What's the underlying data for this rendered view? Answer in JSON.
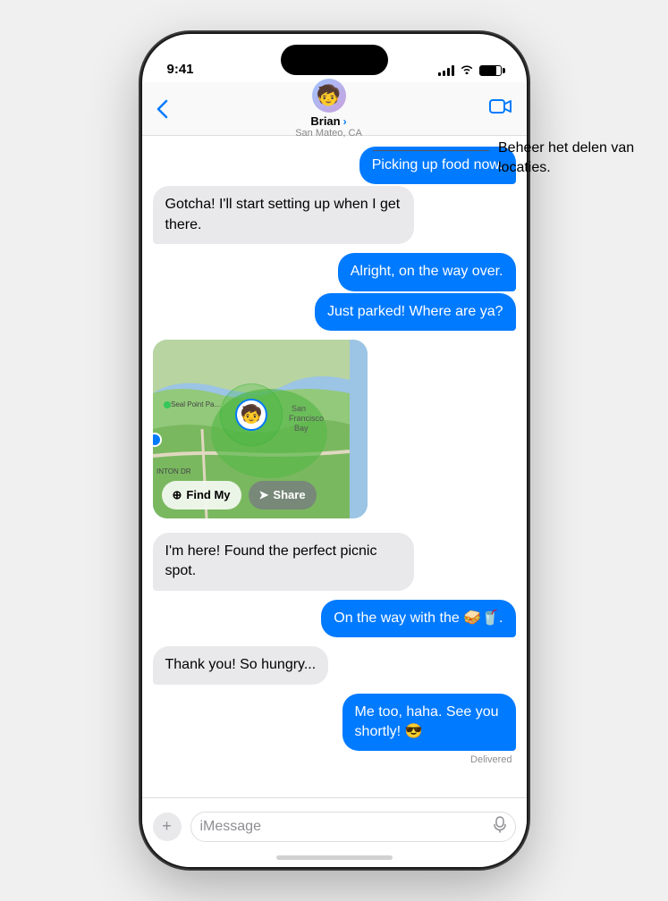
{
  "statusBar": {
    "time": "9:41",
    "battery_level": "80"
  },
  "navBar": {
    "back_label": "‹",
    "contact_name": "Brian",
    "contact_chevron": "›",
    "contact_location": "San Mateo, CA",
    "video_icon": "📹"
  },
  "annotation": {
    "text": "Beheer het delen van locaties.",
    "line": true
  },
  "messages": [
    {
      "id": 1,
      "type": "outgoing",
      "text": "Picking up food now."
    },
    {
      "id": 2,
      "type": "incoming",
      "text": "Gotcha! I'll start setting up when I get there."
    },
    {
      "id": 3,
      "type": "outgoing",
      "text": "Alright, on the way over."
    },
    {
      "id": 4,
      "type": "outgoing",
      "text": "Just parked! Where are ya?"
    },
    {
      "id": 5,
      "type": "map"
    },
    {
      "id": 6,
      "type": "incoming",
      "text": "I'm here! Found the perfect picnic spot."
    },
    {
      "id": 7,
      "type": "outgoing",
      "text": "On the way with the 🥪🥤."
    },
    {
      "id": 8,
      "type": "incoming",
      "text": "Thank you! So hungry..."
    },
    {
      "id": 9,
      "type": "outgoing",
      "text": "Me too, haha. See you shortly! 😎",
      "delivered": true
    }
  ],
  "map": {
    "find_my_label": "Find My",
    "share_label": "Share",
    "label_seal_point": "Seal Point Pa...",
    "label_bay": "San Francisco Bay",
    "label_street": "INTON DR"
  },
  "inputBar": {
    "plus_icon": "+",
    "placeholder": "iMessage",
    "mic_icon": "🎙"
  },
  "delivered_label": "Delivered"
}
